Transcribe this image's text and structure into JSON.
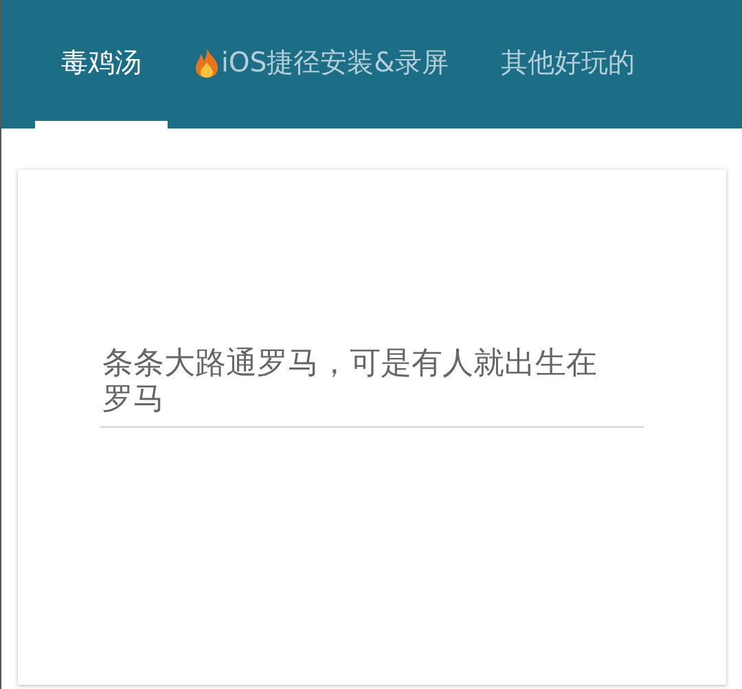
{
  "tabs": [
    {
      "label": "毒鸡汤",
      "selected": true,
      "kind": "plain"
    },
    {
      "label": "iOS捷径安装&录屏",
      "selected": false,
      "kind": "flame"
    },
    {
      "label": "其他好玩的",
      "selected": false,
      "kind": "plain"
    }
  ],
  "quote": {
    "value": "条条大路通罗马，可是有人就出生在罗马"
  }
}
